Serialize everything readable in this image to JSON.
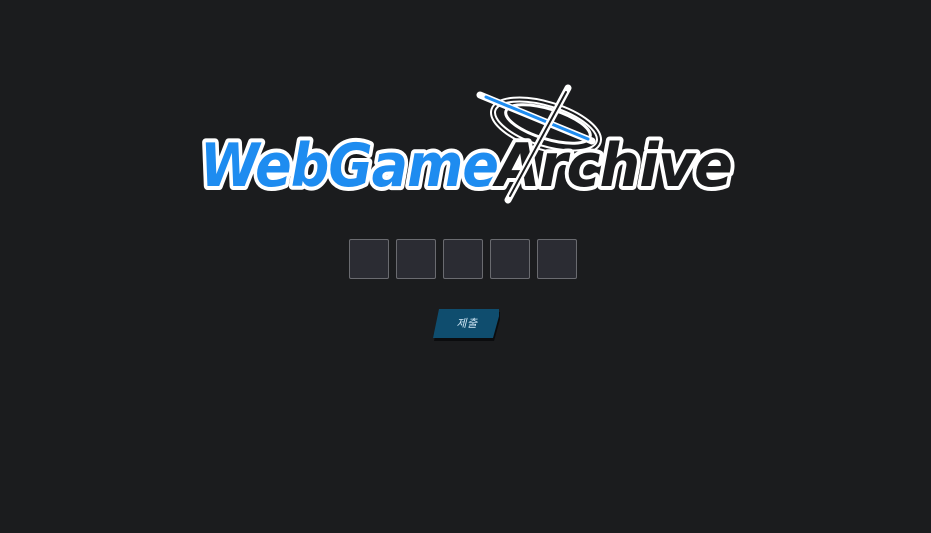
{
  "logo": {
    "part1": "WebGame",
    "part2": "Archive",
    "colors": {
      "blue": "#1e8cf0",
      "white": "#ffffff",
      "outline": "#1b1c1e"
    }
  },
  "code_inputs": [
    {
      "value": "",
      "placeholder": ""
    },
    {
      "value": "",
      "placeholder": ""
    },
    {
      "value": "",
      "placeholder": ""
    },
    {
      "value": "",
      "placeholder": ""
    },
    {
      "value": "",
      "placeholder": ""
    }
  ],
  "submit": {
    "label": "제출",
    "color": "#0f4d6e"
  }
}
